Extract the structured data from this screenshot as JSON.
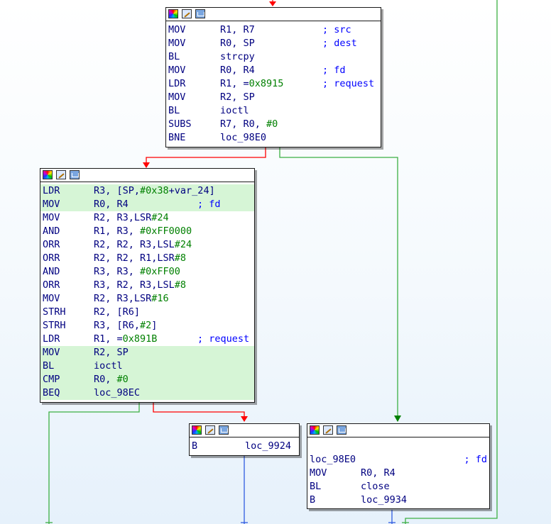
{
  "blocks": {
    "top": {
      "lines": [
        {
          "mn": "MOV",
          "op": "R1, R7",
          "cm": "; src"
        },
        {
          "mn": "MOV",
          "op": "R0, SP",
          "cm": "; dest"
        },
        {
          "mn": "BL",
          "op": "strcpy",
          "cm": ""
        },
        {
          "mn": "MOV",
          "op": "R0, R4",
          "cm": "; fd"
        },
        {
          "mn": "LDR",
          "op": "R1, =0x8915",
          "cm": "; request"
        },
        {
          "mn": "MOV",
          "op": "R2, SP",
          "cm": ""
        },
        {
          "mn": "BL",
          "op": "ioctl",
          "cm": ""
        },
        {
          "mn": "SUBS",
          "op": "R7, R0, #0",
          "cm": ""
        },
        {
          "mn": "BNE",
          "op": "loc_98E0",
          "cm": ""
        }
      ]
    },
    "middle": {
      "lines": [
        {
          "mn": "LDR",
          "op": "R3, [SP,#0x38+var_24]",
          "cm": ""
        },
        {
          "mn": "MOV",
          "op": "R0, R4",
          "cm": "; fd"
        },
        {
          "mn": "MOV",
          "op": "R2, R3,LSR#24",
          "cm": ""
        },
        {
          "mn": "AND",
          "op": "R1, R3, #0xFF0000",
          "cm": ""
        },
        {
          "mn": "ORR",
          "op": "R2, R2, R3,LSL#24",
          "cm": ""
        },
        {
          "mn": "ORR",
          "op": "R2, R2, R1,LSR#8",
          "cm": ""
        },
        {
          "mn": "AND",
          "op": "R3, R3, #0xFF00",
          "cm": ""
        },
        {
          "mn": "ORR",
          "op": "R3, R2, R3,LSL#8",
          "cm": ""
        },
        {
          "mn": "MOV",
          "op": "R2, R3,LSR#16",
          "cm": ""
        },
        {
          "mn": "STRH",
          "op": "R2, [R6]",
          "cm": ""
        },
        {
          "mn": "STRH",
          "op": "R3, [R6,#2]",
          "cm": ""
        },
        {
          "mn": "LDR",
          "op": "R1, =0x891B",
          "cm": "; request"
        },
        {
          "mn": "MOV",
          "op": "R2, SP",
          "cm": ""
        },
        {
          "mn": "BL",
          "op": "ioctl",
          "cm": ""
        },
        {
          "mn": "CMP",
          "op": "R0, #0",
          "cm": ""
        },
        {
          "mn": "BEQ",
          "op": "loc_98EC",
          "cm": ""
        }
      ]
    },
    "small": {
      "lines": [
        {
          "mn": "B",
          "op": "loc_9924",
          "cm": ""
        }
      ]
    },
    "right": {
      "lines": [
        {
          "mn": "",
          "op": "",
          "cm": ""
        },
        {
          "mn": "loc_98E0",
          "op": "",
          "cm": "; fd"
        },
        {
          "mn": "MOV",
          "op": "R0, R4",
          "cm": ""
        },
        {
          "mn": "BL",
          "op": "close",
          "cm": ""
        },
        {
          "mn": "B",
          "op": "loc_9934",
          "cm": ""
        }
      ]
    }
  },
  "colors": {
    "edge_true": "#008000",
    "edge_false": "#ff0000",
    "edge_uncond": "#0000ff",
    "highlight": "#d6f5d6"
  }
}
